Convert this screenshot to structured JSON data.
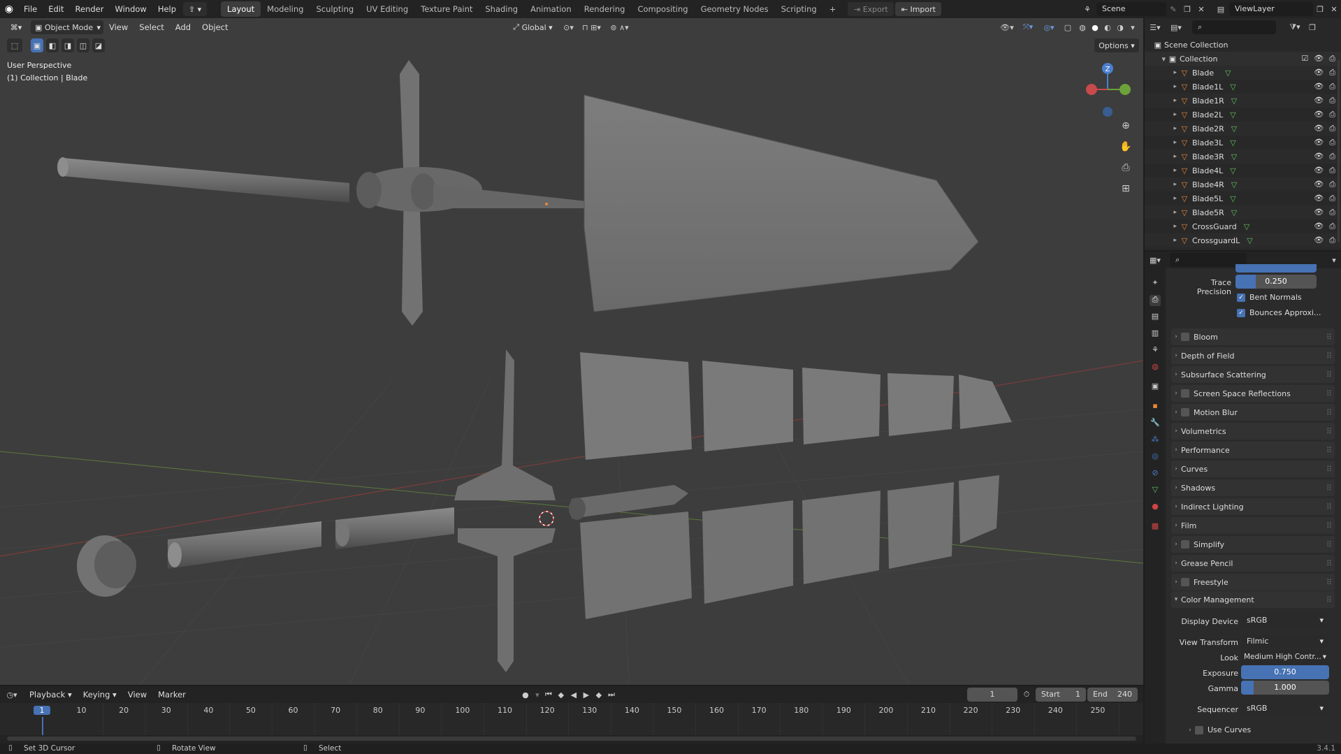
{
  "topbar": {
    "menus": [
      "File",
      "Edit",
      "Render",
      "Window",
      "Help"
    ],
    "workspaces": [
      "Layout",
      "Modeling",
      "Sculpting",
      "UV Editing",
      "Texture Paint",
      "Shading",
      "Animation",
      "Rendering",
      "Compositing",
      "Geometry Nodes",
      "Scripting"
    ],
    "active_workspace": "Layout",
    "export_label": "Export",
    "import_label": "Import",
    "scene_name": "Scene",
    "view_layer": "ViewLayer"
  },
  "viewport": {
    "mode": "Object Mode",
    "menus": [
      "View",
      "Select",
      "Add",
      "Object"
    ],
    "transform_orientation": "Global",
    "options_label": "Options",
    "perspective_label": "User Perspective",
    "context_label": "(1) Collection | Blade",
    "gizmo_axes": {
      "z": "Z"
    }
  },
  "outliner": {
    "scene_collection": "Scene Collection",
    "collection": "Collection",
    "objects": [
      "Blade",
      "Blade1L",
      "Blade1R",
      "Blade2L",
      "Blade2R",
      "Blade3L",
      "Blade3R",
      "Blade4L",
      "Blade4R",
      "Blade5L",
      "Blade5R",
      "CrossGuard",
      "CrossguardL"
    ]
  },
  "properties": {
    "trace_precision_label": "Trace Precision",
    "trace_precision_value": "0.250",
    "bent_normals_label": "Bent Normals",
    "bounces_label": "Bounces Approxi...",
    "panels": [
      {
        "label": "Bloom",
        "checkbox": true
      },
      {
        "label": "Depth of Field",
        "checkbox": false
      },
      {
        "label": "Subsurface Scattering",
        "checkbox": false
      },
      {
        "label": "Screen Space Reflections",
        "checkbox": true
      },
      {
        "label": "Motion Blur",
        "checkbox": true
      },
      {
        "label": "Volumetrics",
        "checkbox": false
      },
      {
        "label": "Performance",
        "checkbox": false
      },
      {
        "label": "Curves",
        "checkbox": false
      },
      {
        "label": "Shadows",
        "checkbox": false
      },
      {
        "label": "Indirect Lighting",
        "checkbox": false
      },
      {
        "label": "Film",
        "checkbox": false
      },
      {
        "label": "Simplify",
        "checkbox": true
      },
      {
        "label": "Grease Pencil",
        "checkbox": false
      },
      {
        "label": "Freestyle",
        "checkbox": true
      }
    ],
    "color_management": {
      "title": "Color Management",
      "display_device_label": "Display Device",
      "display_device": "sRGB",
      "view_transform_label": "View Transform",
      "view_transform": "Filmic",
      "look_label": "Look",
      "look": "Medium High Contr...",
      "exposure_label": "Exposure",
      "exposure": "0.750",
      "gamma_label": "Gamma",
      "gamma": "1.000",
      "sequencer_label": "Sequencer",
      "sequencer": "sRGB",
      "use_curves_label": "Use Curves"
    }
  },
  "timeline": {
    "menus": [
      "Playback",
      "Keying",
      "View",
      "Marker"
    ],
    "current_frame": "1",
    "start_label": "Start",
    "start": "1",
    "end_label": "End",
    "end": "240",
    "ticks": [
      "1",
      "10",
      "20",
      "30",
      "40",
      "50",
      "60",
      "70",
      "80",
      "90",
      "100",
      "110",
      "120",
      "130",
      "140",
      "150",
      "160",
      "170",
      "180",
      "190",
      "200",
      "210",
      "220",
      "230",
      "240",
      "250"
    ]
  },
  "statusbar": {
    "hint1": "Set 3D Cursor",
    "hint2": "Rotate View",
    "hint3": "Select",
    "version": "3.4.1"
  },
  "colors": {
    "accent": "#4772b3",
    "object_orange": "#e8883a",
    "mesh_green": "#5fc45f"
  }
}
